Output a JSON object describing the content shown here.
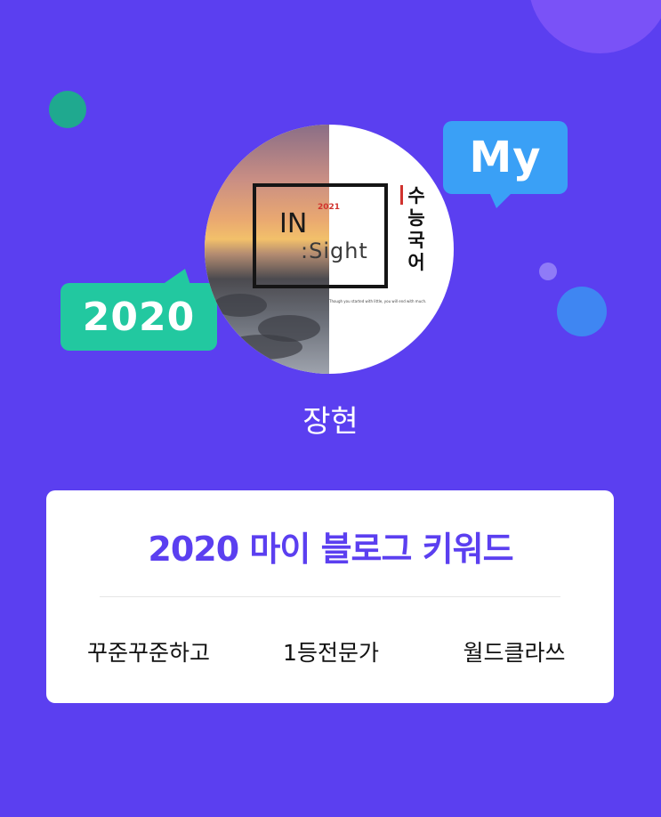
{
  "badges": {
    "my": "My",
    "year": "2020"
  },
  "profile": {
    "logo_in": "IN",
    "logo_year": "2021",
    "logo_sight": ":Sight",
    "logo_title": "수능국어",
    "logo_motto": "Though you started with little, you will end with much.",
    "name": "장현"
  },
  "card": {
    "title": "2020 마이 블로그 키워드",
    "keywords": [
      "꾸준꾸준하고",
      "1등전문가",
      "월드클라쓰"
    ]
  },
  "colors": {
    "background": "#5b3ff0",
    "accent": "#5b3ff0",
    "my_bubble": "#3aa0f6",
    "year_bubble": "#22c8a0"
  }
}
